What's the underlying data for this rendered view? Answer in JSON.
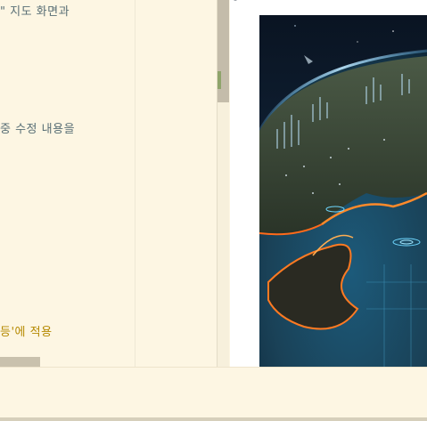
{
  "editor": {
    "lines": [
      {
        "text": "\" 지도 화면과",
        "accent": false
      },
      {
        "text": "중 수정 내용을",
        "accent": false
      },
      {
        "text": "등'에 적용",
        "accent": true
      }
    ]
  },
  "preview": {
    "image_description": "earth-from-space-city-lights-illustration"
  },
  "colors": {
    "background": "#fdf6e3",
    "text": "#586e75",
    "accent": "#b58900",
    "scrollbar": "#c4bcaa"
  }
}
